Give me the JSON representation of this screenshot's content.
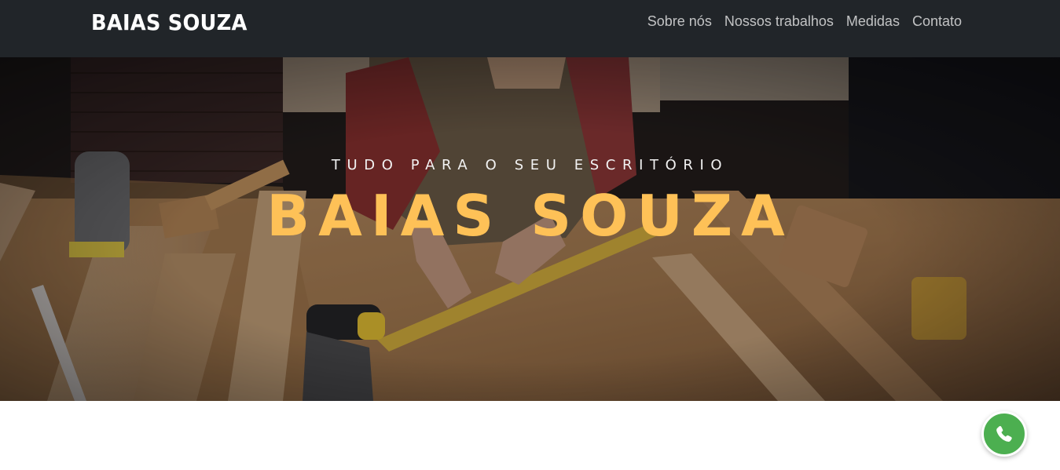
{
  "navbar": {
    "brand": "BAIAS SOUZA",
    "links": [
      "Sobre nós",
      "Nossos trabalhos",
      "Medidas",
      "Contato"
    ]
  },
  "hero": {
    "subtitle": "Tudo para o seu escritório",
    "headline": "BAIAS SOUZA",
    "image_icon": "carpenter-workshop-photo"
  },
  "floating": {
    "whatsapp_icon": "whatsapp-icon"
  },
  "colors": {
    "navbar_bg": "#212529",
    "accent": "#fec157",
    "whatsapp": "#4caf50"
  }
}
